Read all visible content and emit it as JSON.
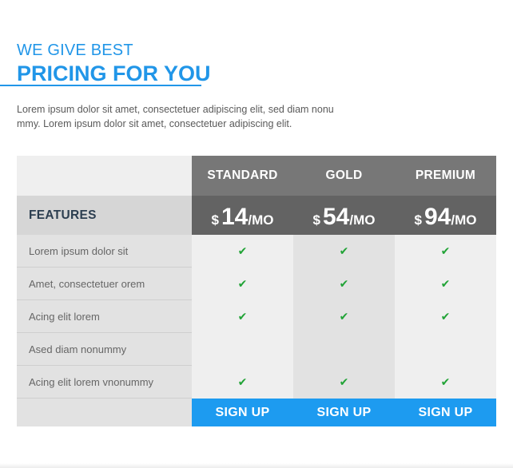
{
  "header": {
    "subtitle": "WE GIVE BEST",
    "title": "PRICING FOR YOU",
    "intro_line1": "Lorem ipsum dolor sit amet, consectetuer adipiscing elit, sed diam nonu",
    "intro_line2": "mmy. Lorem ipsum dolor sit amet, consectetuer adipiscing elit."
  },
  "pricing": {
    "features_label": "FEATURES",
    "currency": "$",
    "period": "/MO",
    "plans": [
      {
        "name": "STANDARD",
        "price": "14",
        "signup_label": "SIGN UP"
      },
      {
        "name": "GOLD",
        "price": "54",
        "signup_label": "SIGN UP"
      },
      {
        "name": "PREMIUM",
        "price": "94",
        "signup_label": "SIGN UP"
      }
    ],
    "check_icon": "✔",
    "features": [
      {
        "label": "Lorem ipsum dolor sit",
        "included": [
          true,
          true,
          true
        ]
      },
      {
        "label": "Amet, consectetuer orem",
        "included": [
          true,
          true,
          true
        ]
      },
      {
        "label": "Acing elit lorem",
        "included": [
          true,
          true,
          true
        ]
      },
      {
        "label": "Ased diam nonummy",
        "included": [
          false,
          false,
          false
        ]
      },
      {
        "label": "Acing elit lorem vnonummy",
        "included": [
          true,
          true,
          true
        ]
      }
    ]
  },
  "colors": {
    "accent": "#2196e8",
    "button": "#1d9bf0",
    "header_gray": "#777777",
    "price_gray": "#636363",
    "check": "#21a336"
  }
}
